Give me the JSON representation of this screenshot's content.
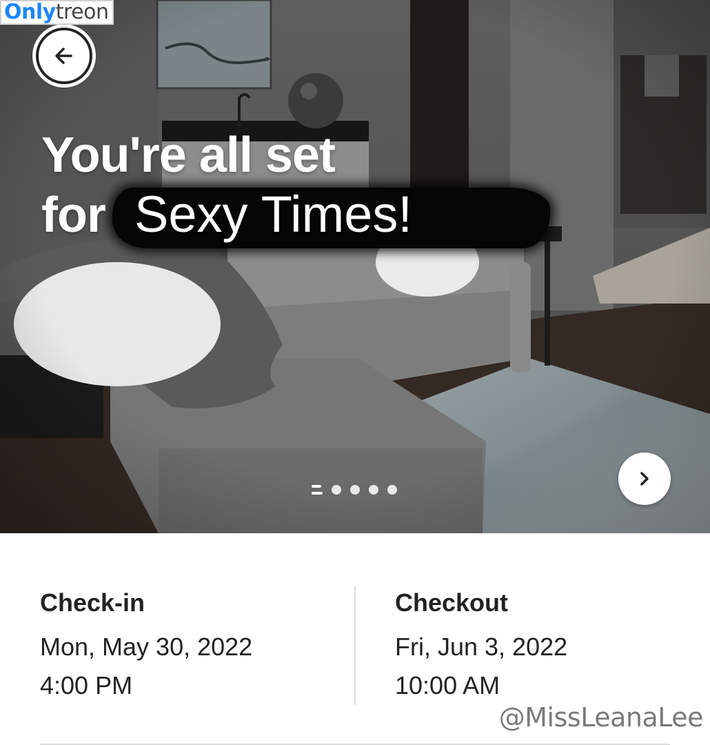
{
  "watermark": {
    "brand_part1": "Only",
    "brand_part2": "treon",
    "handle": "@MissLeanaLee"
  },
  "hero": {
    "title_line1": "You're all set",
    "title_line2_start": "for",
    "title_overlay": "Sexy Times!",
    "carousel": {
      "total_slides": 5,
      "active_index": 0
    },
    "back_icon": "arrow-left-icon",
    "next_icon": "chevron-right-icon"
  },
  "reservation": {
    "checkin": {
      "label": "Check-in",
      "date": "Mon, May 30, 2022",
      "time": "4:00 PM"
    },
    "checkout": {
      "label": "Checkout",
      "date": "Fri, Jun 3, 2022",
      "time": "10:00 AM"
    }
  },
  "colors": {
    "brand_blue": "#1f86ff",
    "text": "#222222",
    "divider": "#dddddd"
  }
}
